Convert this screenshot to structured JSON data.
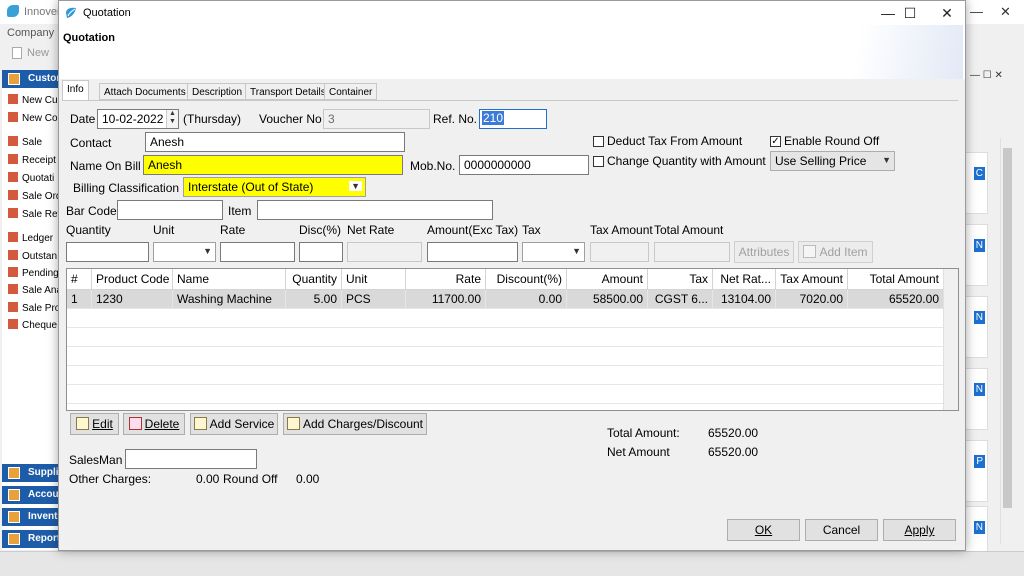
{
  "background_app": {
    "title": "Innoven",
    "menu_company": "Company",
    "toolbar_new": "New",
    "sidebar": {
      "header": "Custom",
      "items": [
        "New Cu",
        "New Co",
        "Sale",
        "Receipt",
        "Quotati",
        "Sale Ord",
        "Sale Ret",
        "Ledger",
        "Outstan",
        "Pending",
        "Sale Ana",
        "Sale Pro",
        "Cheque"
      ],
      "bottom_headers": [
        "Supplie",
        "Accoun",
        "Invent",
        "Report"
      ]
    },
    "cards": [
      "C",
      "N",
      "N",
      "N",
      "P",
      "N"
    ]
  },
  "dialog": {
    "window_title": "Quotation",
    "header": "Quotation",
    "window_buttons": {
      "minimize": "—",
      "maximize": "☐",
      "close": "✕"
    },
    "tabs": [
      {
        "label": "Info",
        "active": true
      },
      {
        "label": "Attach Documents",
        "active": false
      },
      {
        "label": "Description",
        "active": false
      },
      {
        "label": "Transport Details",
        "active": false
      },
      {
        "label": "Container",
        "active": false
      }
    ],
    "form": {
      "date_label": "Date",
      "date_value": "10-02-2022",
      "day_name": "(Thursday)",
      "voucher_label": "Voucher No",
      "voucher_value": "3",
      "ref_label": "Ref. No.",
      "ref_value": "210",
      "contact_label": "Contact",
      "contact_value": "Anesh",
      "name_on_bill_label": "Name On Bill",
      "name_on_bill_value": "Anesh",
      "mob_label": "Mob.No.",
      "mob_value": "0000000000",
      "billing_label": "Billing Classification",
      "billing_value": "Interstate (Out of State)",
      "deduct_tax_label": "Deduct Tax From Amount",
      "deduct_tax_checked": false,
      "enable_round_off_label": "Enable Round Off",
      "enable_round_off_checked": true,
      "change_qty_label": "Change Quantity with Amount",
      "change_qty_checked": false,
      "price_mode_value": "Use Selling Price",
      "barcode_label": "Bar Code",
      "item_label": "Item"
    },
    "entry_row": {
      "labels": [
        "Quantity",
        "Unit",
        "Rate",
        "Disc(%)",
        "Net Rate",
        "Amount(Exc Tax)",
        "Tax",
        "Tax Amount",
        "Total Amount"
      ],
      "attributes_button": "Attributes",
      "add_item_button": "Add Item"
    },
    "grid": {
      "columns": [
        "#",
        "Product Code",
        "Name",
        "Quantity",
        "Unit",
        "Rate",
        "Discount(%)",
        "Amount",
        "Tax",
        "Net Rat...",
        "Tax Amount",
        "Total Amount"
      ],
      "rows": [
        [
          "1",
          "1230",
          "Washing Machine",
          "5.00",
          "PCS",
          "11700.00",
          "0.00",
          "58500.00",
          "CGST 6...",
          "13104.00",
          "7020.00",
          "65520.00"
        ]
      ]
    },
    "actions": {
      "edit": "Edit",
      "delete": "Delete",
      "add_service": "Add Service",
      "add_charges": "Add Charges/Discount"
    },
    "totals": {
      "total_amount_label": "Total Amount:",
      "total_amount_value": "65520.00",
      "net_amount_label": "Net Amount",
      "net_amount_value": "65520.00"
    },
    "footer": {
      "salesman_label": "SalesMan",
      "other_charges_label": "Other Charges:",
      "other_charges_value": "0.00",
      "round_off_label": "Round Off",
      "round_off_value": "0.00"
    },
    "buttons": {
      "ok": "OK",
      "cancel": "Cancel",
      "apply": "Apply"
    }
  }
}
